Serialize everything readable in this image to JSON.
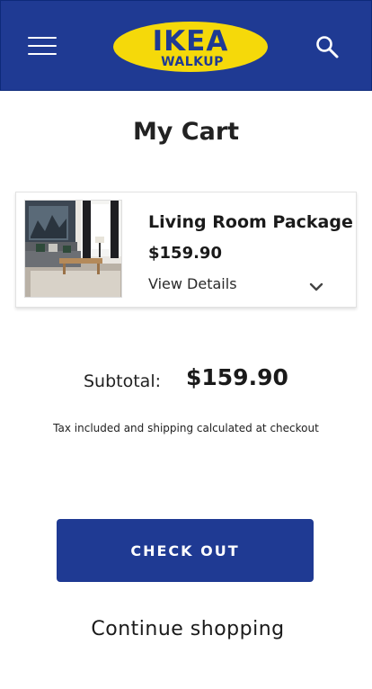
{
  "header": {
    "logo_main": "IKEA",
    "logo_sub": "WALKUP",
    "icons": {
      "menu": "hamburger-menu-icon",
      "search": "search-icon"
    },
    "colors": {
      "background": "#1f3a93",
      "logo_fill": "#f5d90a",
      "logo_text": "#1f3a93"
    }
  },
  "page": {
    "title": "My Cart"
  },
  "cart": {
    "items": [
      {
        "name": "Living Room Package",
        "price": "$159.90",
        "details_label": "View Details",
        "thumbnail": "living-room-photo"
      }
    ]
  },
  "summary": {
    "subtotal_label": "Subtotal:",
    "subtotal_value": "$159.90",
    "tax_note": "Tax included and shipping calculated at checkout"
  },
  "actions": {
    "checkout_label": "CHECK OUT",
    "continue_label": "Continue shopping"
  }
}
